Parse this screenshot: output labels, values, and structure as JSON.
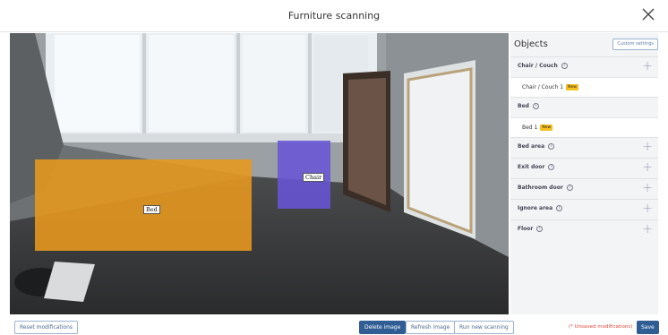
{
  "window": {
    "title": "Furniture scanning",
    "close_icon": "close-icon"
  },
  "overlays": {
    "bed_label": "Bed",
    "chair_label": "Chair",
    "bed_color": "#E8981E",
    "chair_color": "#6854D6"
  },
  "panel": {
    "title": "Objects",
    "custom_settings_label": "Custom settings",
    "categories": [
      {
        "label": "Chair / Couch",
        "items": [
          {
            "label": "Chair / Couch 1",
            "badge": "New"
          }
        ]
      },
      {
        "label": "Bed",
        "items": [
          {
            "label": "Bed 1",
            "badge": "New"
          }
        ]
      },
      {
        "label": "Bed area",
        "items": []
      },
      {
        "label": "Exit door",
        "items": []
      },
      {
        "label": "Bathroom door",
        "items": []
      },
      {
        "label": "Ignore area",
        "items": []
      },
      {
        "label": "Floor",
        "items": []
      }
    ]
  },
  "footer": {
    "reset_label": "Reset modifications",
    "delete_label": "Delete image",
    "refresh_label": "Refresh image",
    "run_label": "Run new scanning",
    "unsaved_label": "(* Unsaved modifications)",
    "save_label": "Save"
  },
  "colors": {
    "accent": "#2F5D94",
    "badge": "#F4C021",
    "warning": "#E0463C"
  }
}
